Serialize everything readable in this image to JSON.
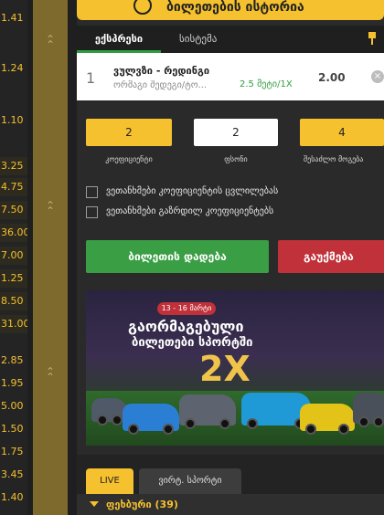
{
  "odds_column": [
    "1.41",
    "1.24",
    "1.10",
    "3.25",
    "4.75",
    "7.50",
    "36.00",
    "7.00",
    "1.25",
    "8.50",
    "31.00",
    "2.85",
    "1.95",
    "5.00",
    "1.50",
    "1.75",
    "3.45",
    "1.40"
  ],
  "header": {
    "title": "ბილეთების ისტორია",
    "icon": "history-icon"
  },
  "tabs": {
    "express": "ექსპრესი",
    "system": "სისტემა"
  },
  "bet": {
    "number": "1",
    "match": "ვულვზი - რედინგი",
    "market": "ორმაგი შედეგი/ტო...",
    "selection": "2.5 მეტი/1X",
    "odds": "2.00",
    "close": "×"
  },
  "summary": [
    {
      "value": "2",
      "label": "კოეფიციენტი"
    },
    {
      "value": "2",
      "label": "ფსონი"
    },
    {
      "value": "4",
      "label": "შესაძლო მოგება"
    }
  ],
  "options": [
    "ვეთანხმები კოეფიციენტის ცვლილებას",
    "ვეთანხმები გაზრდილ კოეფიციენტებს"
  ],
  "buttons": {
    "place": "ბილეთის დადება",
    "cancel": "გაუქმება"
  },
  "banner": {
    "dates": "13 - 16 მარტი",
    "line1": "გაორმაგებული",
    "line2": "ბილეთები სპორტში",
    "multiplier": "2X"
  },
  "bottom": {
    "live": "LIVE",
    "virtual": "ვირტ. სპორტი",
    "category": "ფეხბური (39)"
  },
  "colors": {
    "accent": "#f5c12e",
    "green": "#3a9e45",
    "red": "#c0313a"
  }
}
